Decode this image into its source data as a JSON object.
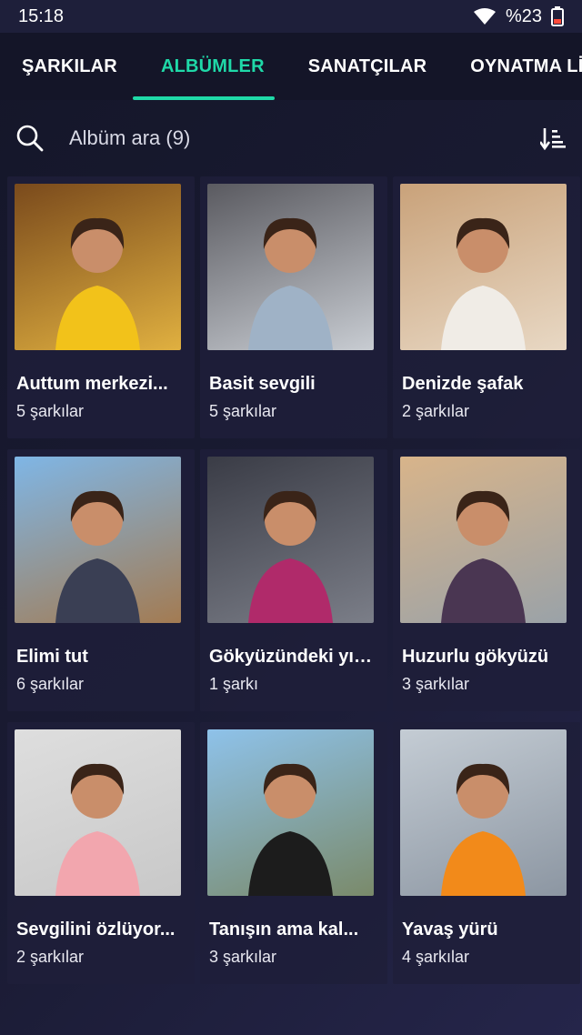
{
  "status": {
    "time": "15:18",
    "battery": "%23"
  },
  "tabs": [
    {
      "label": "ŞARKILAR"
    },
    {
      "label": "ALBÜMLER"
    },
    {
      "label": "SANATÇILAR"
    },
    {
      "label": "OYNATMA LİSTELERİ"
    }
  ],
  "search": {
    "placeholder": "Albüm ara (9)"
  },
  "albums": [
    {
      "title": "Auttum merkezi...",
      "count": "5 şarkılar",
      "bg": [
        "#7a4a1c",
        "#e0b040"
      ],
      "figure": "#f2c21a"
    },
    {
      "title": "Basit sevgili",
      "count": "5 şarkılar",
      "bg": [
        "#5a5a60",
        "#c8ccd2"
      ],
      "figure": "#9fb2c6"
    },
    {
      "title": "Denizde şafak",
      "count": "2 şarkılar",
      "bg": [
        "#c9a27a",
        "#e8d8c4"
      ],
      "figure": "#f0ece6"
    },
    {
      "title": "Elimi tut",
      "count": "6 şarkılar",
      "bg": [
        "#7fb6e6",
        "#a37b52"
      ],
      "figure": "#3a3f54"
    },
    {
      "title": "Gökyüzündeki yıl...",
      "count": "1 şarkı",
      "bg": [
        "#3a3c46",
        "#7b7e88"
      ],
      "figure": "#b02a6a"
    },
    {
      "title": "Huzurlu gökyüzü",
      "count": "3 şarkılar",
      "bg": [
        "#d8b48a",
        "#9aa2a8"
      ],
      "figure": "#4a3652"
    },
    {
      "title": "Sevgilini özlüyor...",
      "count": "2 şarkılar",
      "bg": [
        "#dedede",
        "#c8c8c8"
      ],
      "figure": "#f2a6ae"
    },
    {
      "title": "Tanışın ama kal...",
      "count": "3 şarkılar",
      "bg": [
        "#8ec2ea",
        "#7a8a6a"
      ],
      "figure": "#1c1c1c"
    },
    {
      "title": "Yavaş yürü",
      "count": "4 şarkılar",
      "bg": [
        "#c4ccd4",
        "#8c96a2"
      ],
      "figure": "#f28a1a"
    }
  ]
}
